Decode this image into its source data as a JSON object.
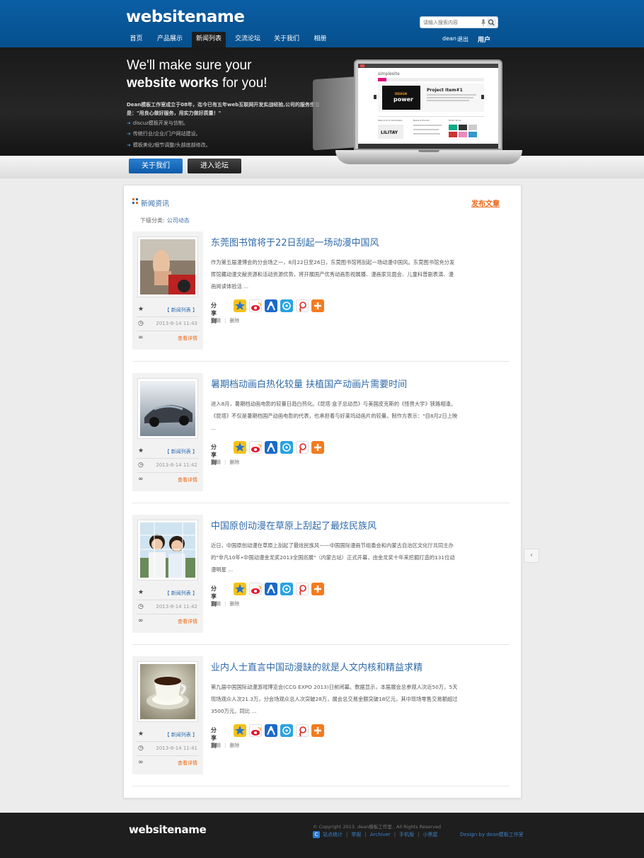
{
  "header": {
    "logo": "websitename",
    "search_placeholder": "请输入搜索内容",
    "nav": [
      {
        "label": "首页"
      },
      {
        "label": "产品展示"
      },
      {
        "label": "新闻列表"
      },
      {
        "label": "交流论坛"
      },
      {
        "label": "关于我们"
      },
      {
        "label": "相册"
      }
    ],
    "user": {
      "name": "dean",
      "logout": "退出",
      "user_menu": "用户"
    }
  },
  "banner": {
    "headline1": "We'll make sure your",
    "headline2_bold": "website works",
    "headline2_rest": " for you!",
    "intro": "Dean模板工作室成立于08年，迄今已有五年web互联网开发实战经验,公司的服务宗旨是：\"用良心做好服务，用实力做好质量！\"",
    "features": [
      "discuz模板开发与仿制。",
      "传统行业/企业/门户网站建设。",
      "模板美化/细节调整/头部底部修改。"
    ],
    "btn_about": "关于我们",
    "btn_forum": "进入论坛"
  },
  "section": {
    "title": "新闻资讯",
    "post_link": "发布文章",
    "subcat_label": "下级分类:",
    "subcat_value": "公司动态"
  },
  "articles": [
    {
      "title": "东莞图书馆将于22日刮起一场动漫中国风",
      "summary": "作为第五届漫博会的分会场之一，8月22日至26日，东莞图书馆将刮起一场动漫中国风。东莞图书馆充分发挥馆藏动漫文献资源和活动资源优势，将开展国产优秀动画影视展播、漫画家见面会、儿童科普剧表演、漫画阅读体验活 ...",
      "category": "【 新闻列表 】",
      "date": "2013-8-14 11:43",
      "more": "查看详情"
    },
    {
      "title": "暑期档动画白热化较量 扶植国产动画片需要时间",
      "summary": "进入8月，暑期档动画电影的较量日趋白热化。《昆塔·盒子总动员》与美国皮克斯的《怪兽大学》狭路相逢。《昆塔》不仅是暑期档国产动画电影的代表，也承担着与好莱坞动画片的较量。制作方表示：\"自8月2日上映 ...",
      "category": "【 新闻列表 】",
      "date": "2013-8-14 11:42",
      "more": "查看详情"
    },
    {
      "title": "中国原创动漫在草原上刮起了最炫民族风",
      "summary": "近日，中国原创动漫在草原上刮起了最炫民族风——中国国际漫画节组委会和内蒙古自治区文化厅共同主办的\"非凡10年•中国动漫金龙奖2013全国巡展\"（内蒙古站）正式开幕，由金龙奖十年来挖掘打造的131位动漫明星 ...",
      "category": "【 新闻列表 】",
      "date": "2013-8-14 11:42",
      "more": "查看详情"
    },
    {
      "title": "业内人士直言中国动漫缺的就是人文内核和精益求精",
      "summary": "第九届中国国际动漫游戏博览会(CCG EXPO 2013)日前闭幕。数据显示，本届展会总参观人次近50万，5天现场观众人次21.3万，分会场观众总人次突破28万，展会总交易金额突破18亿元，其中现场零售交易额超过3500万元，同比 ...",
      "category": "【 新闻列表 】",
      "date": "2013-8-14 11:41",
      "more": "查看详情"
    }
  ],
  "item_ui": {
    "share_label": "分享到",
    "edit": "编辑",
    "delete": "删除"
  },
  "share_icons": [
    "qzone-icon",
    "weibo-icon",
    "renren-icon",
    "pengyou-icon",
    "tencent-weibo-icon",
    "more-share-icon"
  ],
  "colors": {
    "brand_blue": "#0a5fa5",
    "link_blue": "#2f6aa8",
    "accent_orange": "#e8691a"
  },
  "laptop_screen": {
    "site": "simplesite",
    "project_title": "Project Item#1",
    "promo_1": "DESIGN",
    "promo_2": "power",
    "welcome": "Welcome to Simplesite",
    "news": "News & Events",
    "photo": "Photo Show",
    "thumb_brand": "LILITAY"
  },
  "footer": {
    "logo": "websitename",
    "copyright": "© Copyright 2013. dean模板工作室.. All Rights Reserved",
    "badge": "C",
    "links": [
      "站点统计",
      "举报",
      "Archiver",
      "手机版",
      "小黑屋"
    ],
    "design": "Design by dean模板工作室"
  }
}
